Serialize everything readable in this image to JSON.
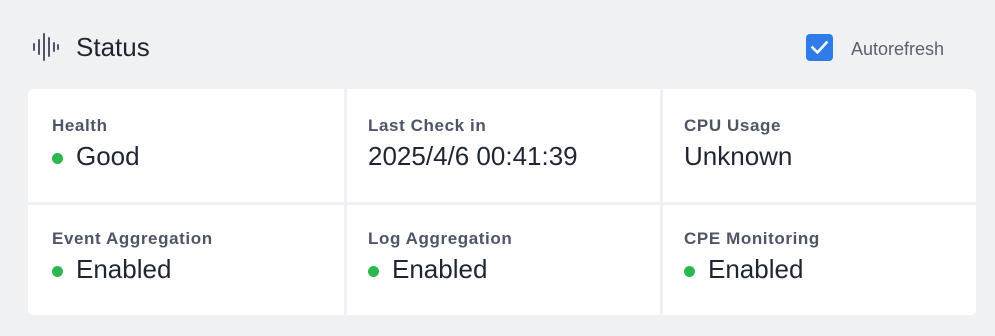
{
  "header": {
    "title": "Status",
    "icon": "audio-waveform-icon",
    "autorefresh": {
      "label": "Autorefresh",
      "checked": true
    }
  },
  "colors": {
    "accent": "#2f7be8",
    "ok": "#2cb84e"
  },
  "cells": [
    {
      "label": "Health",
      "value": "Good",
      "indicator": "green"
    },
    {
      "label": "Last Check in",
      "value": "2025/4/6 00:41:39"
    },
    {
      "label": "CPU Usage",
      "value": "Unknown"
    },
    {
      "label": "Event Aggregation",
      "value": "Enabled",
      "indicator": "green"
    },
    {
      "label": "Log Aggregation",
      "value": "Enabled",
      "indicator": "green"
    },
    {
      "label": "CPE Monitoring",
      "value": "Enabled",
      "indicator": "green"
    }
  ]
}
